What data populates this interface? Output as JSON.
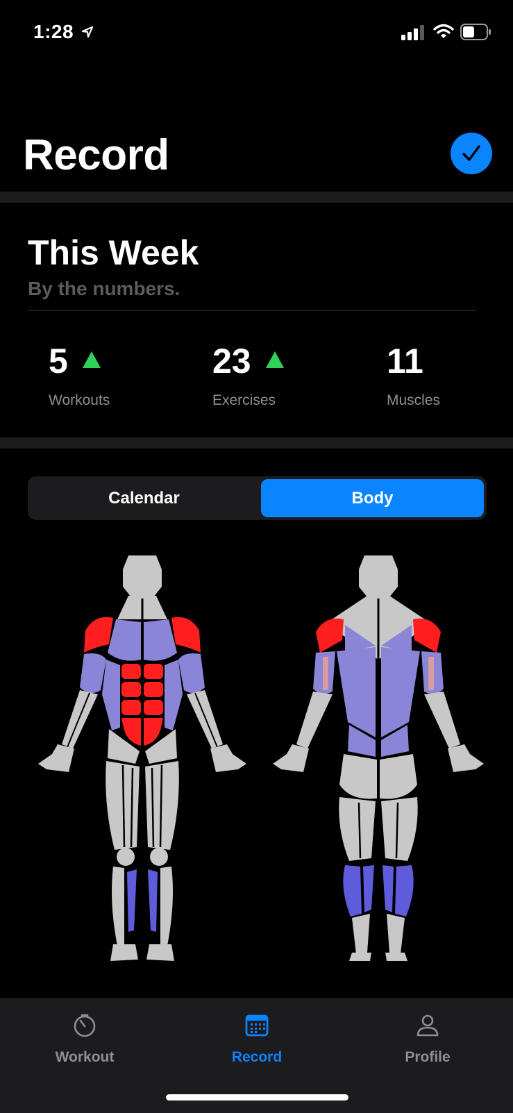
{
  "status_bar": {
    "time": "1:28"
  },
  "header": {
    "title": "Record"
  },
  "summary": {
    "title": "This Week",
    "subtitle": "By the numbers.",
    "stats": [
      {
        "value": "5",
        "label": "Workouts",
        "trend": "up"
      },
      {
        "value": "23",
        "label": "Exercises",
        "trend": "up"
      },
      {
        "value": "11",
        "label": "Muscles",
        "trend": "none"
      }
    ]
  },
  "segmented_control": {
    "options": [
      "Calendar",
      "Body"
    ],
    "selected": "Body"
  },
  "body_map": {
    "colors": {
      "high": "#ff1f1f",
      "medium": "#8a85d6",
      "low": "#5f5cdc",
      "inactive": "#c8c8c8",
      "light_red": "#d99aa0"
    }
  },
  "tab_bar": {
    "tabs": [
      {
        "label": "Workout",
        "icon": "stopwatch-icon",
        "active": false
      },
      {
        "label": "Record",
        "icon": "calendar-icon",
        "active": true
      },
      {
        "label": "Profile",
        "icon": "person-icon",
        "active": false
      }
    ]
  },
  "colors": {
    "accent": "#0a84ff",
    "trend_up": "#30d158"
  }
}
